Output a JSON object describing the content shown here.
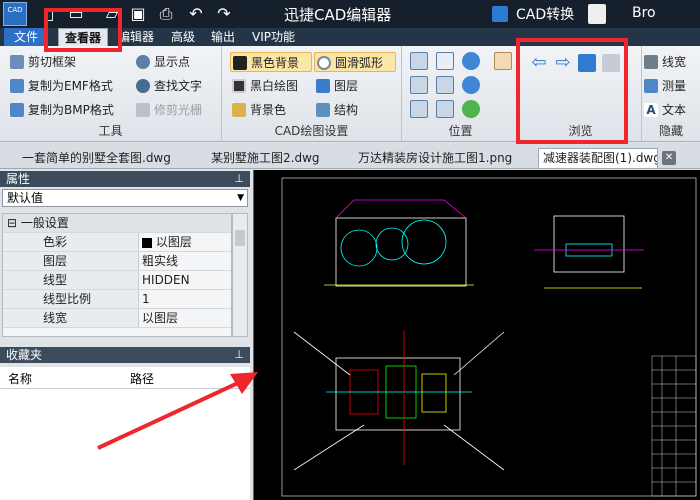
{
  "app": {
    "logo_text": "CAD",
    "title": "迅捷CAD编辑器",
    "convert": "CAD转换",
    "user": "Bro"
  },
  "menu": [
    "文件",
    "查看器",
    "编辑器",
    "高级",
    "输出",
    "VIP功能"
  ],
  "ribbon": {
    "tools": {
      "label": "工具",
      "items": [
        "剪切框架",
        "复制为EMF格式",
        "复制为BMP格式",
        "显示点",
        "查找文字",
        "修剪光栅"
      ]
    },
    "cad_settings": {
      "label": "CAD绘图设置",
      "items": [
        "黑色背景",
        "黑白绘图",
        "背景色",
        "圆滑弧形",
        "图层",
        "结构"
      ]
    },
    "position": {
      "label": "位置"
    },
    "browse": {
      "label": "浏览"
    },
    "hide": {
      "label": "隐藏",
      "items": [
        "线宽",
        "测量",
        "文本"
      ]
    }
  },
  "tabs": [
    "一套简单的别墅全套图.dwg",
    "某别墅施工图2.dwg",
    "万达精装房设计施工图1.png",
    "减速器装配图(1).dwg"
  ],
  "properties": {
    "header": "属性",
    "selected": "默认值",
    "group": "一般设置",
    "rows": [
      {
        "key": "色彩",
        "value": "以图层"
      },
      {
        "key": "图层",
        "value": "粗实线"
      },
      {
        "key": "线型",
        "value": "HIDDEN"
      },
      {
        "key": "线型比例",
        "value": "1"
      },
      {
        "key": "线宽",
        "value": "以图层"
      }
    ]
  },
  "favorites": {
    "header": "收藏夹",
    "columns": [
      "名称",
      "路径"
    ]
  },
  "colors": {
    "accent": "#2d6fc6",
    "annotation": "#f0262d",
    "canvas": "#000000"
  }
}
